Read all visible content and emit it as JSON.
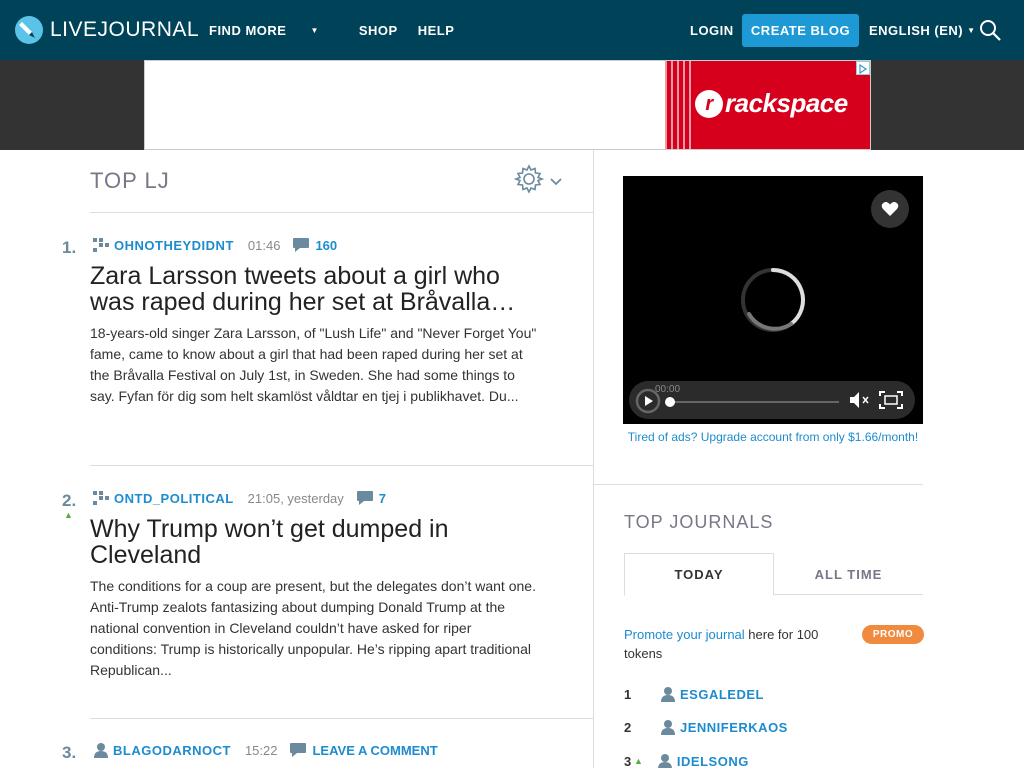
{
  "header": {
    "logo_text": "LIVEJOURNAL",
    "nav": {
      "find_more": "FIND MORE",
      "shop": "SHOP",
      "help": "HELP"
    },
    "login": "LOGIN",
    "create_blog": "CREATE BLOG",
    "language": "ENGLISH (EN)"
  },
  "ad": {
    "brand": "rackspace",
    "brand_mark": "r"
  },
  "main": {
    "title": "TOP LJ",
    "posts": [
      {
        "rank": "1.",
        "journal": "OHNOTHEYDIDNT",
        "time": "01:46",
        "comments": "160",
        "title": "Zara Larsson tweets about a girl who was raped during her set at Bråvalla…",
        "body": "18-years-old singer Zara Larsson, of \"Lush Life\" and \"Never Forget You\" fame, came to know about a girl that had been raped during her set at the Bråvalla Festival on July 1st, in Sweden. She had some things to say. Fyfan för dig som helt skamlöst våldtar en tjej i publikhavet. Du..."
      },
      {
        "rank": "2.",
        "journal": "ONTD_POLITICAL",
        "time": "21:05, yesterday",
        "comments": "7",
        "title": "Why Trump won’t get dumped in Cleveland",
        "body": "The conditions for a coup are present, but the delegates don’t want one. Anti-Trump zealots fantasizing about dumping Donald Trump at the national convention in Cleveland couldn’t have asked for riper conditions: Trump is historically unpopular. He’s ripping apart traditional Republican..."
      },
      {
        "rank": "3.",
        "journal": "BLAGODARNOCT",
        "time": "15:22",
        "comments": "LEAVE A COMMENT"
      }
    ]
  },
  "sidebar": {
    "video_time": "00:00",
    "ads_note": "Tired of ads? Upgrade account from only $1.66/month!",
    "top_journals_title": "TOP JOURNALS",
    "tabs": {
      "today": "TODAY",
      "all_time": "ALL TIME"
    },
    "promo_link": "Promote your journal",
    "promo_rest": " here for 100 tokens",
    "promo_badge": "PROMO",
    "journals": [
      {
        "num": "1",
        "name": "ESGALEDEL"
      },
      {
        "num": "2",
        "name": "JENNIFERKAOS"
      },
      {
        "num": "3",
        "name": "IDELSONG"
      }
    ]
  },
  "colors": {
    "header_bg": "#004359",
    "accent": "#1d9ad6",
    "link": "#1d8ccf",
    "promo": "#f08a3e",
    "rank_up": "#5aaa46"
  }
}
